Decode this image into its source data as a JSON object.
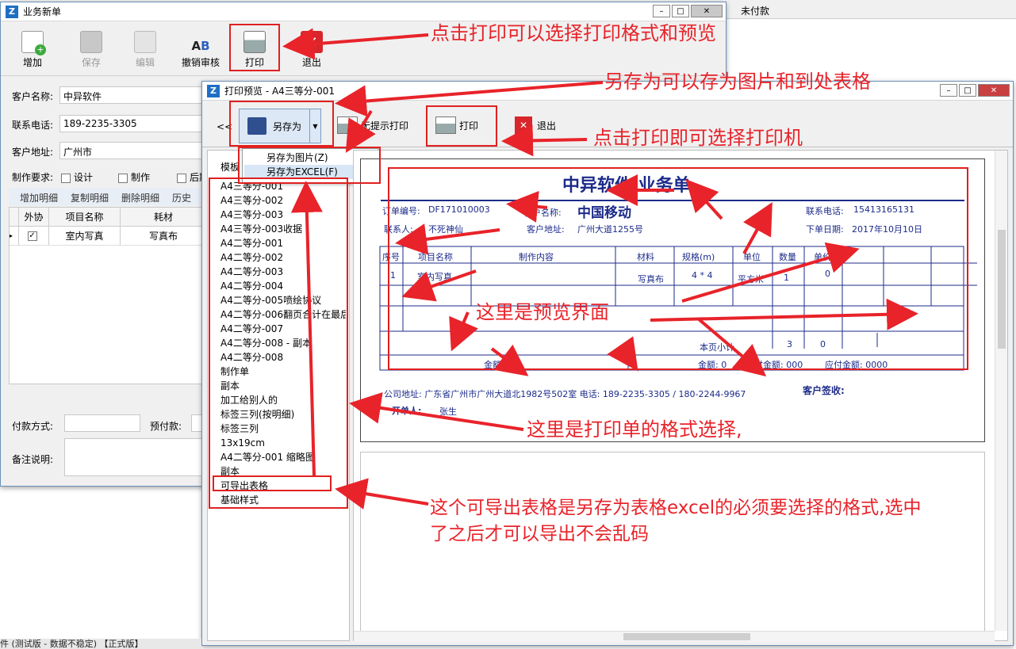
{
  "background": {
    "unpaid": "未付款"
  },
  "main_window": {
    "title": "业务新单",
    "toolbar": {
      "add": "增加",
      "save": "保存",
      "edit": "编辑",
      "revoke": "撤销审核",
      "print": "打印",
      "exit": "退出"
    },
    "fields": {
      "customer_name_label": "客户名称:",
      "customer_name": "中异软件",
      "phone_label": "联系电话:",
      "phone": "189-2235-3305",
      "address_label": "客户地址:",
      "address": "广州市",
      "req_label": "制作要求:",
      "req_design": "设计",
      "req_make": "制作",
      "req_post": "后期"
    },
    "detail_tabs": [
      "增加明细",
      "复制明细",
      "删除明细",
      "历史"
    ],
    "grid": {
      "headers": [
        "外协",
        "项目名称",
        "耗材"
      ],
      "row": {
        "item": "室内写真",
        "material": "写真布"
      }
    },
    "bottom": {
      "pay_label": "付款方式:",
      "prepay_label": "预付款:",
      "note_label": "备注说明:"
    }
  },
  "preview_window": {
    "title": "打印预览 - A4三等分-001",
    "back": "<<",
    "save_as": "另存为",
    "menu": [
      "另存为图片(Z)",
      "另存为EXCEL(F)"
    ],
    "silent_print": "无提示打印",
    "print": "打印",
    "exit": "退出",
    "template_label": "模板",
    "templates": [
      "A4三等分-001",
      "A4三等分-002",
      "A4三等分-003",
      "A4三等分-003收据",
      "A4二等分-001",
      "A4二等分-002",
      "A4二等分-003",
      "A4二等分-004",
      "A4二等分-005喷绘协议",
      "A4二等分-006翻页合计在最后",
      "A4二等分-007",
      "A4二等分-008 - 副本",
      "A4二等分-008",
      "制作单",
      "副本",
      "加工给别人的",
      "标签三列(按明细)",
      "标签三列",
      "13x19cm",
      "A4二等分-001 缩略图",
      "副本",
      "可导出表格",
      "基础样式"
    ],
    "doc": {
      "title": "中异软件  业务单",
      "order_no_label": "订单编号:",
      "order_no": "DF171010003",
      "cust_name_label": "客户名称:",
      "cust_name": "中国移动",
      "phone_label": "联系电话:",
      "phone": "15413165131",
      "contact_label": "联系人:",
      "contact": "不死神仙",
      "addr_label": "客户地址:",
      "addr": "广州大道1255号",
      "date_label": "下单日期:",
      "date": "2017年10月10日",
      "headers": [
        "序号",
        "项目名称",
        "制作内容",
        "材料",
        "规格(m)",
        "单位",
        "数量",
        "单价"
      ],
      "row": [
        "1",
        "室内写真",
        "",
        "写真布",
        "4 * 4",
        "平方米",
        "1",
        "0"
      ],
      "subtotal_label": "本页小计",
      "subtotal_qty": "3",
      "subtotal_amt": "0",
      "amount_words": "金额: 零",
      "amount": "金额: 0",
      "prepaid": "预付金额: 000",
      "due": "应付金额: 0000",
      "company_addr": "公司地址: 广东省广州市广州大道北1982号502室   电话: 189-2235-3305 / 180-2244-9967",
      "sign": "客户签收:",
      "maker_label": "开单人:",
      "maker": "张生"
    }
  },
  "annotations": {
    "a1": "点击打印可以选择打印格式和预览",
    "a2": "另存为可以存为图片和到处表格",
    "a3": "点击打印即可选择打印机",
    "a4": "这里是预览界面",
    "a5": "这里是打印单的格式选择,",
    "a6_line1": "这个可导出表格是另存为表格excel的必须要选择的格式,选中",
    "a6_line2": "了之后才可以导出不会乱码"
  },
  "status_bar": "件 (测试版 - 数据不稳定) 【正式版】",
  "colors": {
    "annotation": "#e8232a",
    "doc_text": "#1c2b8a",
    "title_icon": "#1e6fc4"
  }
}
